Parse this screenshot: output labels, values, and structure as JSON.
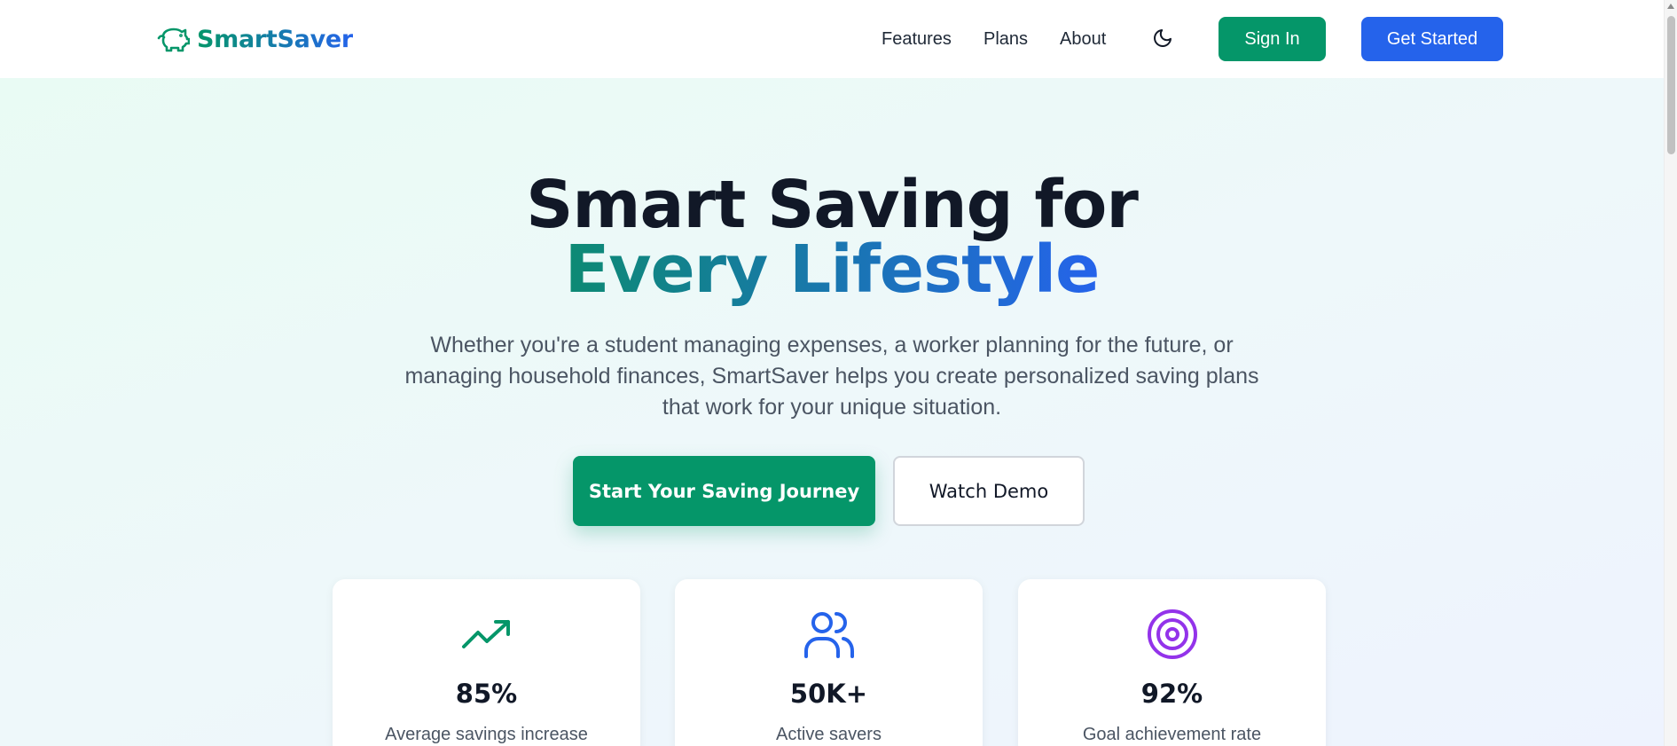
{
  "brand": {
    "name": "SmartSaver",
    "logo_icon": "piggy-bank-icon"
  },
  "nav": {
    "links": [
      "Features",
      "Plans",
      "About"
    ],
    "theme_toggle_icon": "moon-icon",
    "signin_label": "Sign In",
    "getstarted_label": "Get Started"
  },
  "hero": {
    "title_line1": "Smart Saving for",
    "title_line2": "Every Lifestyle",
    "subtitle_lines": [
      "Whether you're a student managing expenses, a worker planning for the future, or",
      "managing household finances, SmartSaver helps you create personalized saving plans",
      "that work for your unique situation."
    ],
    "primary_cta": "Start Your Saving Journey",
    "secondary_cta": "Watch Demo"
  },
  "stats": [
    {
      "icon": "trending-up-icon",
      "value": "85%",
      "label": "Average savings increase",
      "color": "#059669"
    },
    {
      "icon": "users-icon",
      "value": "50K+",
      "label": "Active savers",
      "color": "#2563eb"
    },
    {
      "icon": "target-icon",
      "value": "92%",
      "label": "Goal achievement rate",
      "color": "#9333ea"
    }
  ],
  "colors": {
    "green": "#059669",
    "blue": "#2563eb",
    "purple": "#9333ea",
    "heading": "#111827",
    "body": "#4b5563"
  }
}
